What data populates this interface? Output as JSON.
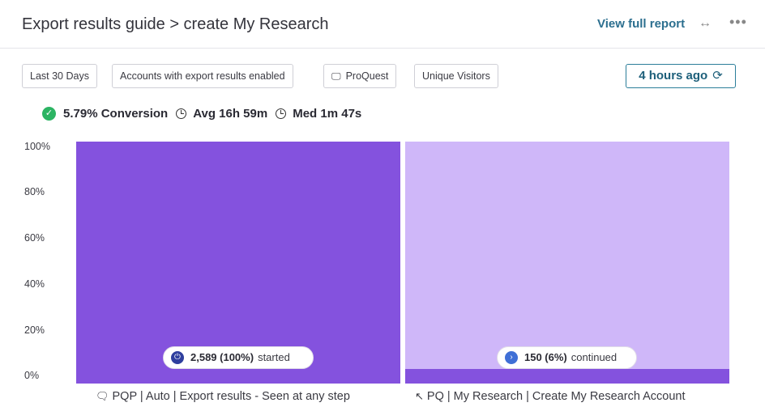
{
  "header": {
    "title": "Export results guide > create My Research",
    "view_report_label": "View full report",
    "expand_icon": "↔",
    "more_icon": "•••"
  },
  "filters": [
    {
      "label": "Last 30 Days"
    },
    {
      "label": "Accounts with export results enabled"
    },
    {
      "label": "ProQuest",
      "icon": "monitor-icon"
    },
    {
      "label": "Unique Visitors"
    }
  ],
  "refresh": {
    "label": "4 hours ago",
    "icon": "refresh-icon"
  },
  "stats": {
    "conversion": "5.79% Conversion",
    "avg": "Avg 16h 59m",
    "median": "Med 1m 47s"
  },
  "colors": {
    "bar_primary": "#8452de",
    "bar_background": "#cfb7f9",
    "conversion_green": "#2cb463",
    "badge_start": "#2f3f9e",
    "badge_continue": "#3f6fd6"
  },
  "chart_data": {
    "type": "bar",
    "ylim": [
      0,
      100
    ],
    "y_ticks": [
      "100%",
      "80%",
      "60%",
      "40%",
      "20%",
      "0%"
    ],
    "steps": [
      {
        "label": "PQP | Auto | Export results - Seen at any step",
        "icon": "monitor-icon",
        "percent": 100,
        "badge_count": "2,589 (100%)",
        "badge_word": "started"
      },
      {
        "label": "PQ | My Research | Create My Research Account",
        "icon": "cursor-icon",
        "percent": 6,
        "badge_count": "150 (6%)",
        "badge_word": "continued"
      }
    ]
  }
}
